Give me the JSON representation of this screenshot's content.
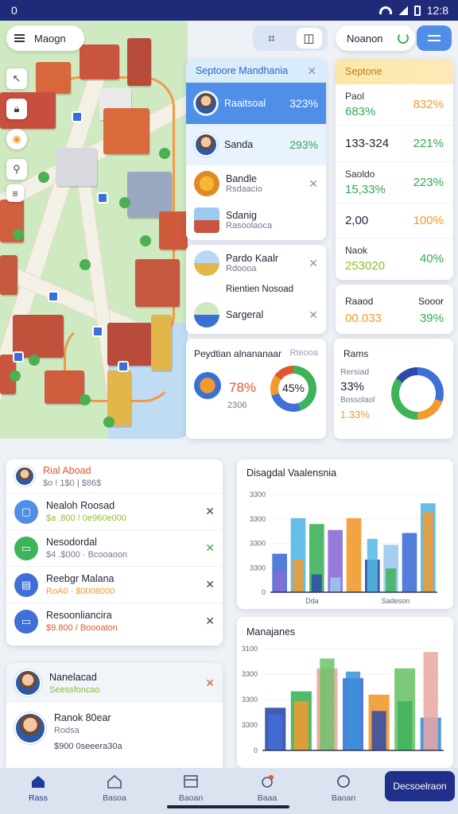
{
  "status": {
    "left": "0",
    "time": "12:8"
  },
  "topbar": {
    "search_label": "Maogn",
    "name_label": "Noanon"
  },
  "panel1": {
    "header": "Septoore Mandhania",
    "items": [
      {
        "name": "Raaitsoal",
        "value": "323%"
      },
      {
        "name": "Sanda",
        "value": "293%"
      },
      {
        "name": "Bandle",
        "sub": "Rsdaacio"
      },
      {
        "name": "Sdanig",
        "sub": "Rasoolaoca"
      }
    ]
  },
  "panel2": {
    "items": [
      {
        "name": "Pardo Kaalr",
        "sub": "Rdoooa"
      },
      {
        "name": "Rientien Nosoad"
      },
      {
        "name": "Sargeral"
      }
    ]
  },
  "stats": {
    "header": "Septone",
    "rows": [
      {
        "label": "Paol",
        "left": "683%",
        "right": "832%"
      },
      {
        "label": "",
        "left": "133-324",
        "right": "221%"
      },
      {
        "label": "Saoldo",
        "left": "15,33%",
        "right": "223%"
      },
      {
        "label": "",
        "left": "2,00",
        "right": "100%"
      },
      {
        "label": "Naok",
        "left": "253020",
        "right": "40%"
      },
      {
        "label": "Raaod",
        "left": "00.033",
        "right": "39%",
        "right_label": "Sooor"
      }
    ]
  },
  "donut_panel": {
    "title": "Peydtian alnananaar",
    "tag": "Rteooa",
    "value1": "78%",
    "value2": "2306",
    "donut_value": "45%"
  },
  "rates_panel": {
    "title": "Rams",
    "label1": "Rersiad",
    "value1": "33%",
    "label2": "Bossolaol",
    "value2": "1.33%"
  },
  "list1": {
    "header": {
      "title": "Rial Aboad",
      "sub": "$o ! 1$0 | $86$"
    },
    "items": [
      {
        "title": "Nealoh Roosad",
        "sub": "$a .800 / 0e960e000"
      },
      {
        "title": "Nesodordal",
        "sub": "$4 .$000 · Bcooaoon"
      },
      {
        "title": "Reebgr Malana",
        "sub": "RoA0 · $0008000"
      },
      {
        "title": "Resoonliancira",
        "sub": "$9.800 / Boooaton"
      }
    ]
  },
  "list2": {
    "header": {
      "title": "Nanelacad",
      "sub": "Seessfoncao"
    },
    "item": {
      "title": "Ranok 80ear",
      "sub": "Rodsa",
      "note": "$900 0seeera30a"
    }
  },
  "chart1": {
    "title": "Disagdal Vaalensnia",
    "ticks": [
      "3300",
      "3300",
      "3300",
      "3300",
      "0"
    ],
    "xlabels": [
      "Dda",
      "Sadeson"
    ]
  },
  "chart2": {
    "title": "Manajanes",
    "ticks": [
      "3100",
      "3300",
      "3300",
      "3300",
      "0"
    ]
  },
  "chart_data": [
    {
      "type": "bar",
      "title": "Disagdal Vaalensnia",
      "ylim": [
        0,
        3300
      ],
      "series": [
        {
          "values": [
            1300,
            2500,
            2300,
            2100,
            2500,
            1100,
            1600,
            2000,
            3000
          ]
        },
        {
          "values": [
            700,
            1100,
            600,
            500,
            0,
            1800,
            800,
            0,
            2700
          ]
        }
      ],
      "colors": [
        "#3f6fd7",
        "#53b7e4",
        "#3db35a",
        "#8a6bd6",
        "#f29a2e",
        "#2e4aa8",
        "#9cc9ef"
      ]
    },
    {
      "type": "bar",
      "title": "Manajanes",
      "ylim": [
        0,
        3100
      ],
      "series": [
        {
          "values": [
            1300,
            1800,
            2500,
            2200,
            1700,
            2500,
            1000
          ]
        },
        {
          "values": [
            1100,
            1500,
            2800,
            2400,
            1200,
            1500,
            3000
          ]
        }
      ],
      "colors": [
        "#2e4aa8",
        "#3db35a",
        "#e9a7a0",
        "#3f6fd7",
        "#f29a2e",
        "#6fc36b",
        "#3a8fd8"
      ]
    }
  ],
  "nav": {
    "items": [
      {
        "label": "Rass"
      },
      {
        "label": "Basoa"
      },
      {
        "label": "Baoan"
      },
      {
        "label": "Baaa"
      },
      {
        "label": "Baoan"
      }
    ],
    "cta": "Decsoelraon"
  }
}
